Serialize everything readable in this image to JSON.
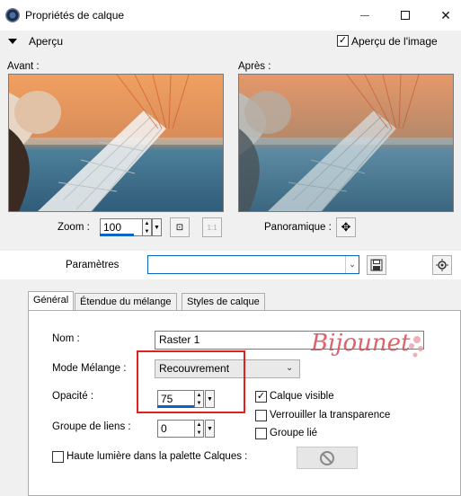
{
  "window": {
    "title": "Propriétés de calque",
    "min_glyph": "—",
    "max_glyph": "☐",
    "close_glyph": "✕"
  },
  "preview": {
    "toggle_label": "Aperçu",
    "show_image_label": "Aperçu de l'image",
    "show_image_checked": true,
    "before_label": "Avant :",
    "after_label": "Après :",
    "zoom_label": "Zoom :",
    "zoom_value": "100",
    "pan_label": "Panoramique :",
    "one_to_one_glyph": "1:1",
    "pan_glyph": "✥"
  },
  "parameters": {
    "label": "Paramètres",
    "value": ""
  },
  "tabs": [
    {
      "label": "Général",
      "active": true
    },
    {
      "label": "Étendue du mélange",
      "active": false
    },
    {
      "label": "Styles de calque",
      "active": false
    }
  ],
  "general": {
    "name_label": "Nom :",
    "name_value": "Raster 1",
    "blend_label": "Mode Mélange :",
    "blend_value": "Recouvrement",
    "opacity_label": "Opacité :",
    "opacity_value": "75",
    "link_group_label": "Groupe de liens :",
    "link_group_value": "0",
    "visible_label": "Calque visible",
    "visible_checked": true,
    "lock_label": "Verrouiller la transparence",
    "lock_checked": false,
    "group_linked_label": "Groupe lié",
    "group_linked_checked": false,
    "highlight_label": "Haute lumière dans la palette Calques :",
    "highlight_checked": false
  },
  "watermark": {
    "text": "Bijounet"
  },
  "colors": {
    "accent": "#0a64c8",
    "annotation_red": "#e0201e",
    "watermark": "#d9535a"
  }
}
